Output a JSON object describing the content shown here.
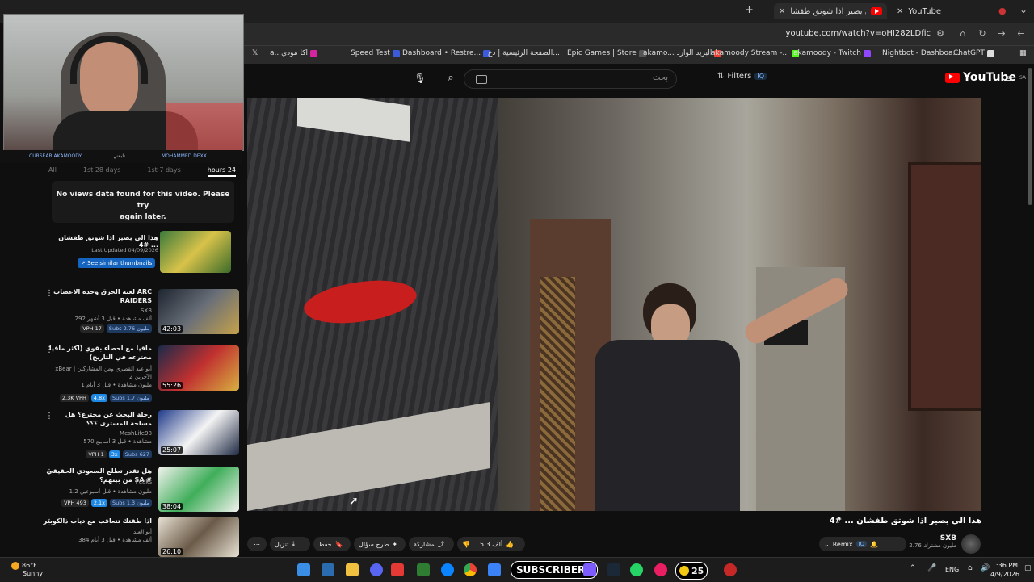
{
  "browser": {
    "tabs": [
      {
        "label": "هذا الي يصير اذا شوتق طفشا",
        "active": true
      },
      {
        "label": "YouTube",
        "active": false
      }
    ],
    "url": "youtube.com/watch?v=oHI282LDfic",
    "bookmarks": [
      "a.. اكا مودي",
      "Speed Test",
      "Dashboard • Restre...",
      "الصفحة الرئيسية | دع...",
      "Epic Games | Store",
      "akamo... البريد الوارد",
      "akamoody Stream -...",
      "akamoody - Twitch",
      "Nightbot - Dashboa...",
      "ChatGPT"
    ]
  },
  "youtube": {
    "search_placeholder": "بحث",
    "filters_label": "Filters",
    "filters_badge": "IQ",
    "brand": "YouTube",
    "brand_country": "SA"
  },
  "sidebar": {
    "range_tabs": [
      "All",
      "1st 28 days",
      "1st 7 days",
      "hours 24"
    ],
    "no_views_line1": "No views data found for this video. Please try",
    "no_views_line2": "again later.",
    "current": {
      "title": "هذا الي يصير اذا شوتق طفشان ... #4",
      "updated": "Last Updated 04/09/2026",
      "similar_button": "See similar thumbnails"
    },
    "videos": [
      {
        "title": "لعبة الحرق وحده الاعصاب ARC RAIDERS",
        "channel": "SXB",
        "meta1": "292 ألف مشاهدة • قبل 3 أشهر",
        "subs": "Subs 2.76 مليون",
        "vph": "VPH 17",
        "multiplier": "",
        "duration": "42:03"
      },
      {
        "title": "ماقيا مع احصاء بقوي (اكثر ماقيا مخترعه في التاريخ)",
        "channel": "xBear | أبو عبد القصري ومن المشاركين الآخرين 2",
        "meta1": "1 مليون مشاهدة • قبل 3 أيام",
        "subs": "Subs 1.7 مليون",
        "vph": "2.3K VPH",
        "multiplier": "4.8x",
        "duration": "55:26"
      },
      {
        "title": "رحلة البحث عن محترع؟ هل مساحة المسترى ؟؟؟",
        "channel": "MeshLife98",
        "meta1": "570 مشاهدة • قبل 3 أسابيع",
        "subs": "Subs 627",
        "vph": "VPH 1",
        "multiplier": "3x",
        "duration": "25:07"
      },
      {
        "title": "هل تقدر تطلع السعودي الحقيقي من بينهم؟ SA #",
        "channel": "Peaks",
        "meta1": "1.2 مليون مشاهدة • قبل أسبوعين",
        "subs": "Subs 1.3 مليون",
        "vph": "VPH 493",
        "multiplier": "2.1x",
        "duration": "38:04"
      },
      {
        "title": "اذا طقتك تتعاقب مع دياب ذالكوبتر",
        "channel": "أبو العبد",
        "meta1": "384 ألف مشاهدة • قبل 3 أيام",
        "subs": "",
        "vph": "",
        "multiplier": "",
        "duration": "26:10"
      }
    ]
  },
  "video": {
    "title": "هذا الي يصير اذا شوتق طفشان ... #4",
    "channel_name": "SXB",
    "channel_subs": "2.76 مليون مشترك",
    "remix_label": "Remix",
    "likes": "5.3 ألف",
    "share_label": "مشاركة",
    "remove_label": "طرح سؤال",
    "save_label": "حفظ",
    "download_label": "تنزيل"
  },
  "taskbar": {
    "temp": "86°F",
    "condition": "Sunny",
    "subscribers_overlay": "SUBSCRIBERS",
    "coin_count": "25",
    "lang": "ENG",
    "time": "1:36 PM",
    "date": "4/9/2026"
  },
  "overlay": {
    "name_left": "CURSEAR AKAMOODY",
    "name_right": "MOHAMMED DEXX",
    "label_mid": "تابعني"
  }
}
